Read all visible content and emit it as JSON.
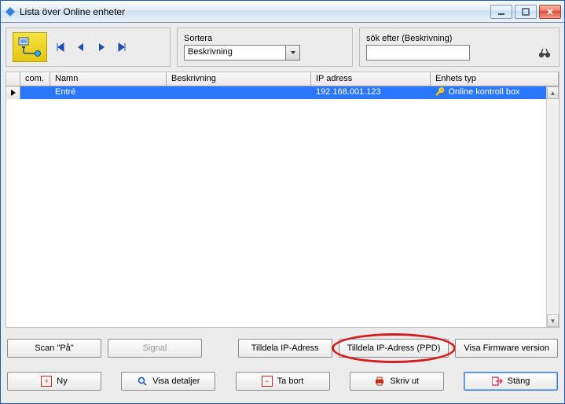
{
  "title": "Lista över Online enheter",
  "sort": {
    "label": "Sortera",
    "value": "Beskrivning"
  },
  "search": {
    "label": "sök efter (Beskrivning)",
    "value": ""
  },
  "columns": {
    "com": "com.",
    "name": "Namn",
    "desc": "Beskrivning",
    "ip": "IP adress",
    "type": "Enhets typ"
  },
  "rows": [
    {
      "com": "",
      "name": "Entré",
      "desc": "",
      "ip": "192.168.001.123",
      "type": "Online kontroll box"
    }
  ],
  "actions": {
    "scan": "Scan \"På\"",
    "signal": "Signal",
    "assign_ip": "Tilldela IP-Adress",
    "assign_ip_ppd": "Tilldela IP-Adress (PPD)",
    "firmware": "Visa Firmware version"
  },
  "footer": {
    "new": "Ny",
    "details": "Visa detaljer",
    "delete": "Ta bort",
    "print": "Skriv ut",
    "close": "Stäng"
  }
}
